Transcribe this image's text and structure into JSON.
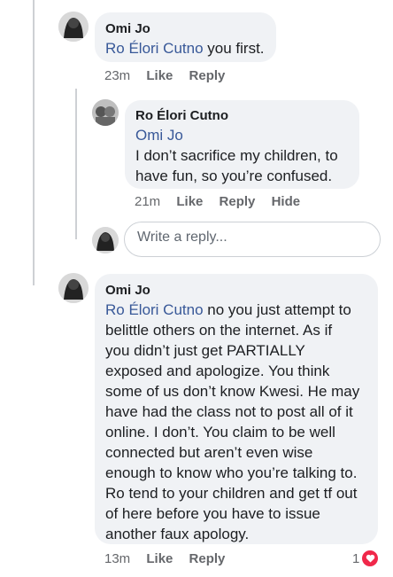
{
  "comments": [
    {
      "author": "Omi Jo",
      "mention": "Ro Élori Cutno",
      "text": " you first.",
      "time": "23m",
      "actions": [
        "Like",
        "Reply"
      ]
    },
    {
      "author": "Ro Élori Cutno",
      "mention": "Omi Jo",
      "lines": [
        "I don’t sacrifice my children, to",
        "have fun, so you’re confused."
      ],
      "time": "21m",
      "actions": [
        "Like",
        "Reply",
        "Hide"
      ]
    },
    {
      "author": "Omi Jo",
      "mention": "Ro Élori Cutno",
      "first_line_rest": " no you just attempt to",
      "lines": [
        "belittle others on the internet. As if",
        "you didn’t just get PARTIALLY",
        "exposed and apologize. You think",
        "some of us don’t know Kwesi. He may",
        "have had the class not to post all of it",
        "online. I don’t. You claim to be well",
        "connected but aren’t even wise",
        "enough to know who you’re talking to.",
        "Ro tend to your children and get tf out",
        "of here before you have to issue",
        "another faux apology."
      ],
      "time": "13m",
      "actions": [
        "Like",
        "Reply"
      ],
      "reaction_count": "1"
    }
  ],
  "reply_box": {
    "placeholder": "Write a reply..."
  },
  "colors": {
    "mention": "#385898",
    "bubble": "#f0f2f5",
    "reaction": "#f0284a"
  }
}
